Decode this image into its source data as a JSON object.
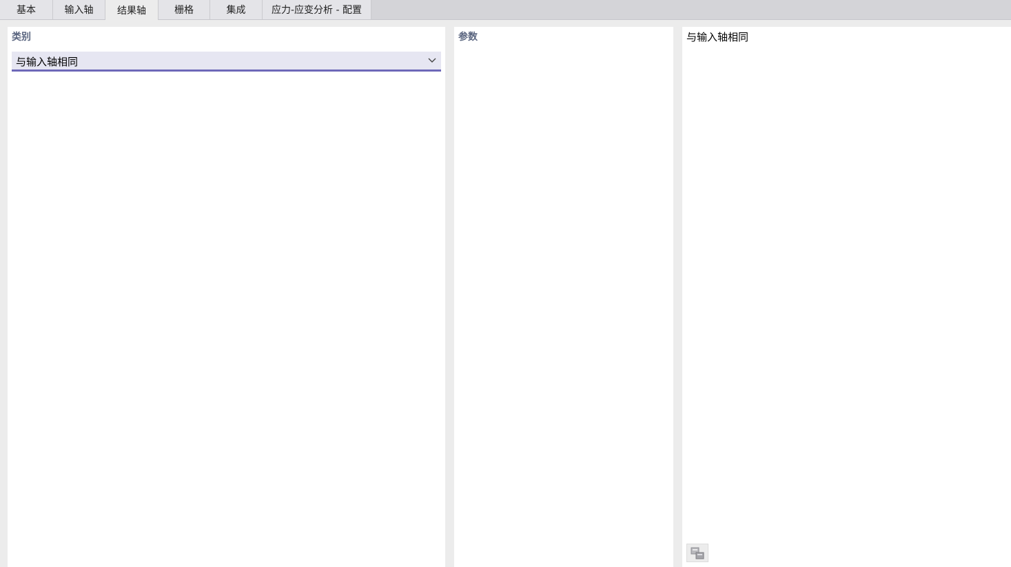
{
  "tabs": [
    {
      "label": "基本",
      "active": false
    },
    {
      "label": "输入轴",
      "active": false
    },
    {
      "label": "结果轴",
      "active": true
    },
    {
      "label": "栅格",
      "active": false
    },
    {
      "label": "集成",
      "active": false
    },
    {
      "label": "应力-应变分析 - 配置",
      "active": false
    }
  ],
  "category_panel": {
    "title": "类别",
    "selected_value": "与输入轴相同",
    "arrow_icon": "chevron-down-icon"
  },
  "params_panel": {
    "title": "参数"
  },
  "preview_panel": {
    "text": "与输入轴相同",
    "icon": "data-view-icon"
  },
  "colors": {
    "section_title": "#5b6680",
    "combo_background": "#e6e6f2",
    "combo_underline": "#6d68b8",
    "app_background": "#ececec"
  }
}
